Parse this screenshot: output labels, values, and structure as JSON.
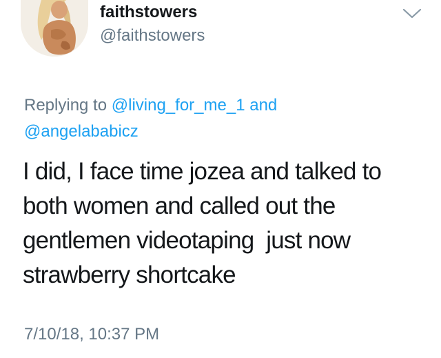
{
  "author": {
    "display_name": "faithstowers",
    "handle": "@faithstowers",
    "avatar_icon": "profile-photo"
  },
  "menu": {
    "icon": "chevron-down-icon"
  },
  "reply_context": {
    "prefix": "Replying to",
    "mention_1": "@living_for_me_1",
    "conjunction": "and",
    "mention_2": "@angelababicz"
  },
  "tweet": {
    "text": "I did, I face time jozea and talked to both women and called out the gentlemen videotaping  just now strawberry shortcake",
    "timestamp": "7/10/18, 10:37 PM"
  },
  "colors": {
    "link": "#1da1f2",
    "secondary_text": "#657786",
    "primary_text": "#14171a"
  }
}
